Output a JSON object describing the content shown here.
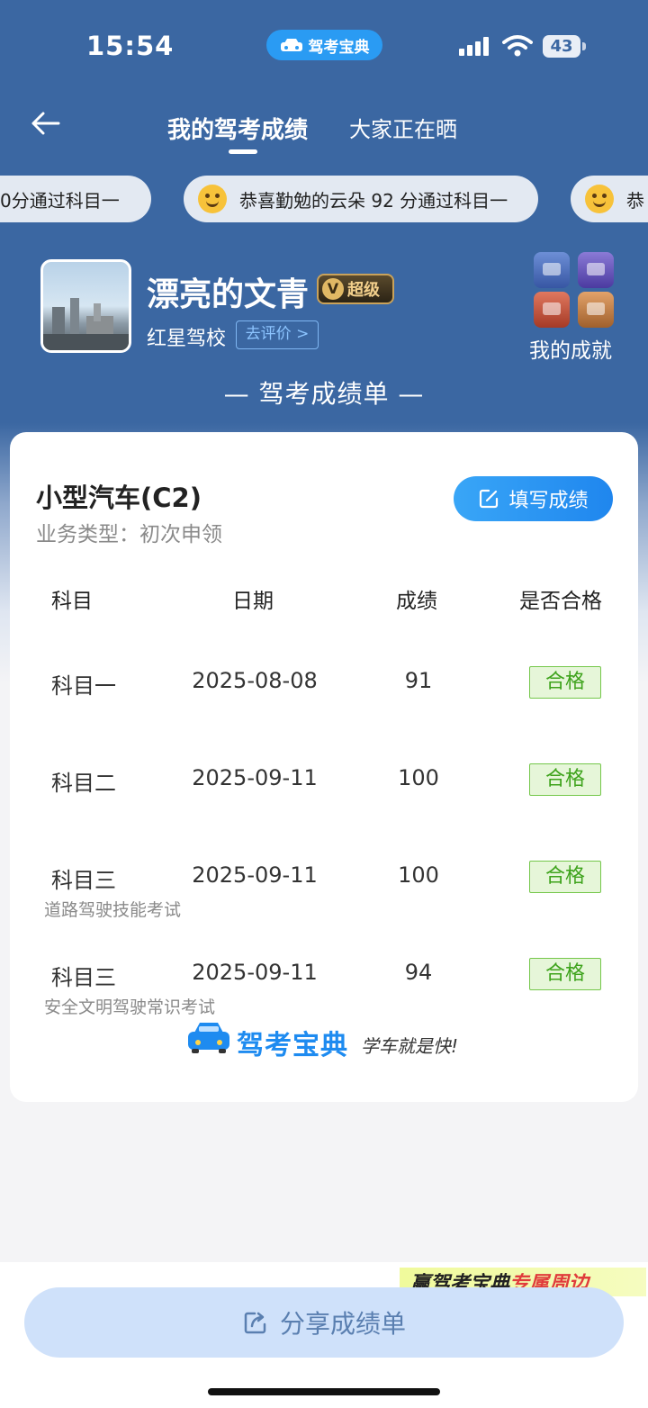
{
  "status_bar": {
    "time": "15:54",
    "app_name": "驾考宝典",
    "battery": "43"
  },
  "nav": {
    "tabs": [
      "我的驾考成绩",
      "大家正在晒"
    ],
    "active_tab": 0
  },
  "ticker": [
    "0分通过科目一",
    "恭喜勤勉的云朵 92 分通过科目一",
    "恭"
  ],
  "profile": {
    "username": "漂亮的文青",
    "vip_label": "超级",
    "school": "红星驾校",
    "rate_button": "去评价 >",
    "achievements": "我的成就"
  },
  "section_title": "— 驾考成绩单 —",
  "card": {
    "car_type": "小型汽车(C2)",
    "business_type": "业务类型：初次申领",
    "fill_button": "填写成绩",
    "headers": [
      "科目",
      "日期",
      "成绩",
      "是否合格"
    ],
    "rows": [
      {
        "subject": "科目一",
        "date": "2025-08-08",
        "score": "91",
        "status": "合格",
        "note": ""
      },
      {
        "subject": "科目二",
        "date": "2025-09-11",
        "score": "100",
        "status": "合格",
        "note": ""
      },
      {
        "subject": "科目三",
        "date": "2025-09-11",
        "score": "100",
        "status": "合格",
        "note": "道路驾驶技能考试"
      },
      {
        "subject": "科目三",
        "date": "2025-09-11",
        "score": "94",
        "status": "合格",
        "note": "安全文明驾驶常识考试"
      }
    ],
    "brand_name": "驾考宝典",
    "brand_slogan": "学车就是快!"
  },
  "promo": {
    "prefix": "赢驾考宝典",
    "accent": "专属周边"
  },
  "share_button": "分享成绩单",
  "colors": {
    "header_bg": "#3b67a2",
    "accent_blue": "#1f86ee",
    "pass_green": "#3ea31c"
  }
}
